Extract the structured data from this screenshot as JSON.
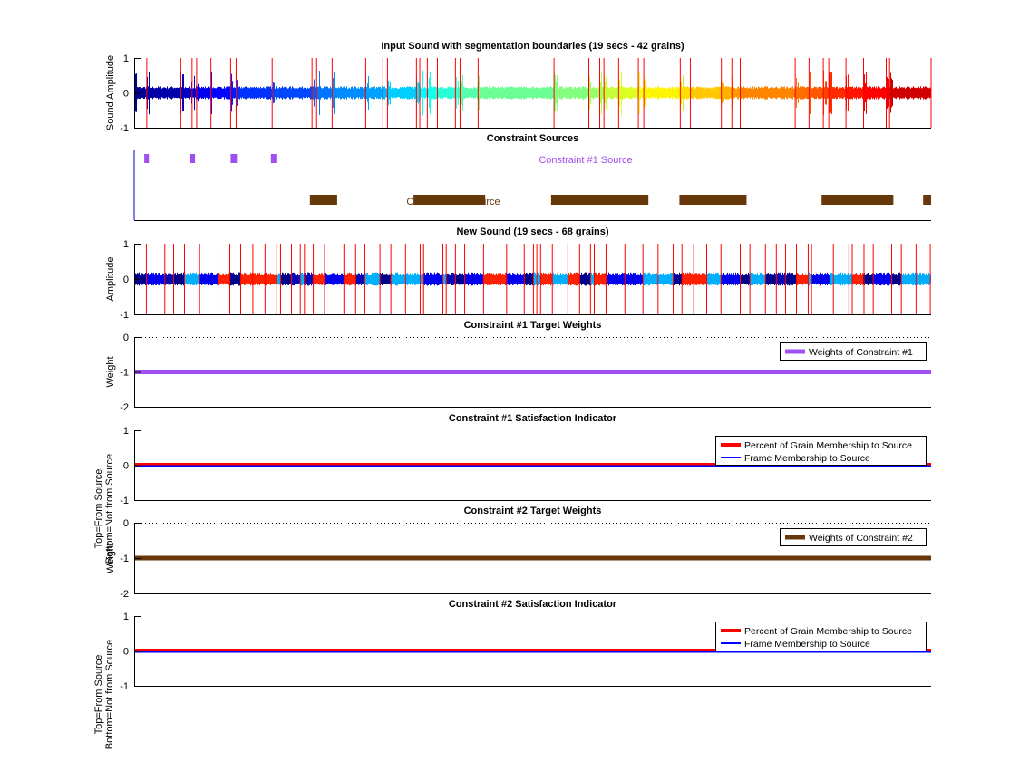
{
  "chart_data": [
    {
      "type": "line",
      "title": "Input Sound with segmentation boundaries (19 secs - 42 grains)",
      "ylabel": "Sound Amplitude",
      "xlim": [
        0,
        19
      ],
      "ylim": [
        -1,
        1
      ],
      "yticks": [
        "1",
        "0",
        "-1"
      ],
      "colormap": "jet",
      "boundary_color": "#ff0000",
      "boundaries": [
        0.3,
        1.11,
        1.38,
        1.49,
        1.83,
        2.3,
        2.43,
        3.29,
        4.24,
        4.35,
        4.72,
        5.52,
        5.93,
        6.04,
        6.73,
        6.81,
        6.99,
        7.23,
        7.66,
        7.77,
        8.2,
        10.01,
        10.84,
        11.1,
        11.2,
        11.55,
        12.02,
        12.15,
        13.02,
        13.26,
        14.0,
        14.25,
        14.45,
        15.76,
        16.09,
        16.43,
        16.56,
        16.97,
        17.39,
        17.93,
        18.01,
        19.0
      ]
    },
    {
      "type": "bar",
      "title": "Constraint Sources",
      "xlim": [
        0,
        19
      ],
      "sources": [
        {
          "label": "Constraint #1 Source",
          "color": "#a050f0",
          "intervals": [
            [
              0.24,
              0.35
            ],
            [
              1.34,
              1.45
            ],
            [
              2.3,
              2.45
            ],
            [
              3.26,
              3.39
            ]
          ]
        },
        {
          "label": "Constraint #2 Source",
          "color": "#66380a",
          "intervals": [
            [
              4.19,
              4.84
            ],
            [
              6.66,
              8.37
            ],
            [
              9.94,
              12.26
            ],
            [
              13.0,
              14.6
            ],
            [
              16.39,
              18.1
            ],
            [
              18.81,
              19.0
            ]
          ]
        }
      ]
    },
    {
      "type": "line",
      "title": "New Sound (19 secs - 68 grains)",
      "ylabel": "Amplitude",
      "xlim": [
        0,
        19
      ],
      "ylim": [
        -1,
        1
      ],
      "yticks": [
        "1",
        "0",
        "-1"
      ],
      "boundary_color": "#ff0000",
      "palette": {
        "N": "#00008c",
        "B": "#0000ee",
        "M": "#0a0ab4",
        "L": "#00b0ff",
        "R": "#ff2000"
      },
      "boundaries": [
        0.29,
        0.73,
        0.94,
        1.2,
        1.56,
        2.0,
        2.28,
        2.54,
        2.83,
        3.12,
        3.4,
        3.49,
        3.75,
        3.96,
        4.06,
        4.27,
        4.54,
        5.0,
        5.28,
        5.5,
        5.86,
        6.12,
        6.47,
        6.82,
        6.9,
        7.36,
        7.44,
        7.66,
        7.88,
        8.33,
        8.88,
        9.3,
        9.52,
        9.6,
        9.69,
        9.97,
        10.34,
        10.62,
        10.88,
        10.97,
        11.25,
        11.7,
        12.13,
        12.49,
        12.85,
        13.06,
        13.34,
        13.65,
        13.99,
        14.45,
        14.68,
        15.05,
        15.31,
        15.53,
        15.79,
        16.07,
        16.15,
        16.59,
        16.67,
        17.04,
        17.12,
        17.4,
        17.62,
        18.06,
        18.29,
        18.64,
        18.98
      ],
      "grain_colors": "NBMNLBRNRRRLNMLMRBRMLNLLLBLMNBRBNLLRLRNLRBBLLNRRLBNLNMNRLBLLLRNBNLLL"
    },
    {
      "type": "line",
      "title": "Constraint #1 Target Weights",
      "ylabel": "Weight",
      "xlim": [
        0,
        19
      ],
      "ylim": [
        -2,
        0
      ],
      "yticks": [
        "0",
        "-1",
        "-2"
      ],
      "series": [
        {
          "name": "Weights of Constraint #1",
          "color": "#a050f0",
          "y": -1
        }
      ]
    },
    {
      "type": "line",
      "title": "Constraint #1 Satisfaction Indicator",
      "ylabel": [
        "Top=From Source",
        "Bottom=Not from Source"
      ],
      "xlim": [
        0,
        19
      ],
      "ylim": [
        -1,
        1
      ],
      "yticks": [
        "1",
        "0",
        "-1"
      ],
      "series": [
        {
          "name": "Percent of Grain Membership to Source",
          "color": "#ff0000",
          "y": 0
        },
        {
          "name": "Frame Membership to Source",
          "color": "#0000ff",
          "y": 0
        }
      ]
    },
    {
      "type": "line",
      "title": "Constraint #2 Target Weights",
      "ylabel": "Weight",
      "xlim": [
        0,
        19
      ],
      "ylim": [
        -2,
        0
      ],
      "yticks": [
        "0",
        "-1",
        "-2"
      ],
      "series": [
        {
          "name": "Weights of Constraint #2",
          "color": "#66380a",
          "y": -1
        }
      ]
    },
    {
      "type": "line",
      "title": "Constraint #2 Satisfaction Indicator",
      "ylabel": [
        "Top=From Source",
        "Bottom=Not from Source"
      ],
      "xlim": [
        0,
        19
      ],
      "ylim": [
        -1,
        1
      ],
      "yticks": [
        "1",
        "0",
        "-1"
      ],
      "series": [
        {
          "name": "Percent of Grain Membership to Source",
          "color": "#ff0000",
          "y": 0
        },
        {
          "name": "Frame Membership to Source",
          "color": "#0000ff",
          "y": 0
        }
      ]
    }
  ]
}
